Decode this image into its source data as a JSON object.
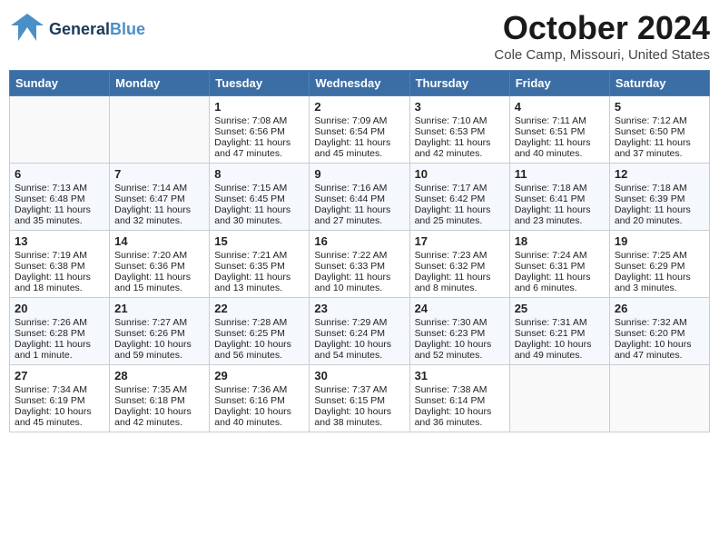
{
  "header": {
    "logo_line1": "General",
    "logo_line2": "Blue",
    "month_title": "October 2024",
    "location": "Cole Camp, Missouri, United States"
  },
  "days_of_week": [
    "Sunday",
    "Monday",
    "Tuesday",
    "Wednesday",
    "Thursday",
    "Friday",
    "Saturday"
  ],
  "weeks": [
    [
      {
        "day": "",
        "content": ""
      },
      {
        "day": "",
        "content": ""
      },
      {
        "day": "1",
        "content": "Sunrise: 7:08 AM\nSunset: 6:56 PM\nDaylight: 11 hours and 47 minutes."
      },
      {
        "day": "2",
        "content": "Sunrise: 7:09 AM\nSunset: 6:54 PM\nDaylight: 11 hours and 45 minutes."
      },
      {
        "day": "3",
        "content": "Sunrise: 7:10 AM\nSunset: 6:53 PM\nDaylight: 11 hours and 42 minutes."
      },
      {
        "day": "4",
        "content": "Sunrise: 7:11 AM\nSunset: 6:51 PM\nDaylight: 11 hours and 40 minutes."
      },
      {
        "day": "5",
        "content": "Sunrise: 7:12 AM\nSunset: 6:50 PM\nDaylight: 11 hours and 37 minutes."
      }
    ],
    [
      {
        "day": "6",
        "content": "Sunrise: 7:13 AM\nSunset: 6:48 PM\nDaylight: 11 hours and 35 minutes."
      },
      {
        "day": "7",
        "content": "Sunrise: 7:14 AM\nSunset: 6:47 PM\nDaylight: 11 hours and 32 minutes."
      },
      {
        "day": "8",
        "content": "Sunrise: 7:15 AM\nSunset: 6:45 PM\nDaylight: 11 hours and 30 minutes."
      },
      {
        "day": "9",
        "content": "Sunrise: 7:16 AM\nSunset: 6:44 PM\nDaylight: 11 hours and 27 minutes."
      },
      {
        "day": "10",
        "content": "Sunrise: 7:17 AM\nSunset: 6:42 PM\nDaylight: 11 hours and 25 minutes."
      },
      {
        "day": "11",
        "content": "Sunrise: 7:18 AM\nSunset: 6:41 PM\nDaylight: 11 hours and 23 minutes."
      },
      {
        "day": "12",
        "content": "Sunrise: 7:18 AM\nSunset: 6:39 PM\nDaylight: 11 hours and 20 minutes."
      }
    ],
    [
      {
        "day": "13",
        "content": "Sunrise: 7:19 AM\nSunset: 6:38 PM\nDaylight: 11 hours and 18 minutes."
      },
      {
        "day": "14",
        "content": "Sunrise: 7:20 AM\nSunset: 6:36 PM\nDaylight: 11 hours and 15 minutes."
      },
      {
        "day": "15",
        "content": "Sunrise: 7:21 AM\nSunset: 6:35 PM\nDaylight: 11 hours and 13 minutes."
      },
      {
        "day": "16",
        "content": "Sunrise: 7:22 AM\nSunset: 6:33 PM\nDaylight: 11 hours and 10 minutes."
      },
      {
        "day": "17",
        "content": "Sunrise: 7:23 AM\nSunset: 6:32 PM\nDaylight: 11 hours and 8 minutes."
      },
      {
        "day": "18",
        "content": "Sunrise: 7:24 AM\nSunset: 6:31 PM\nDaylight: 11 hours and 6 minutes."
      },
      {
        "day": "19",
        "content": "Sunrise: 7:25 AM\nSunset: 6:29 PM\nDaylight: 11 hours and 3 minutes."
      }
    ],
    [
      {
        "day": "20",
        "content": "Sunrise: 7:26 AM\nSunset: 6:28 PM\nDaylight: 11 hours and 1 minute."
      },
      {
        "day": "21",
        "content": "Sunrise: 7:27 AM\nSunset: 6:26 PM\nDaylight: 10 hours and 59 minutes."
      },
      {
        "day": "22",
        "content": "Sunrise: 7:28 AM\nSunset: 6:25 PM\nDaylight: 10 hours and 56 minutes."
      },
      {
        "day": "23",
        "content": "Sunrise: 7:29 AM\nSunset: 6:24 PM\nDaylight: 10 hours and 54 minutes."
      },
      {
        "day": "24",
        "content": "Sunrise: 7:30 AM\nSunset: 6:23 PM\nDaylight: 10 hours and 52 minutes."
      },
      {
        "day": "25",
        "content": "Sunrise: 7:31 AM\nSunset: 6:21 PM\nDaylight: 10 hours and 49 minutes."
      },
      {
        "day": "26",
        "content": "Sunrise: 7:32 AM\nSunset: 6:20 PM\nDaylight: 10 hours and 47 minutes."
      }
    ],
    [
      {
        "day": "27",
        "content": "Sunrise: 7:34 AM\nSunset: 6:19 PM\nDaylight: 10 hours and 45 minutes."
      },
      {
        "day": "28",
        "content": "Sunrise: 7:35 AM\nSunset: 6:18 PM\nDaylight: 10 hours and 42 minutes."
      },
      {
        "day": "29",
        "content": "Sunrise: 7:36 AM\nSunset: 6:16 PM\nDaylight: 10 hours and 40 minutes."
      },
      {
        "day": "30",
        "content": "Sunrise: 7:37 AM\nSunset: 6:15 PM\nDaylight: 10 hours and 38 minutes."
      },
      {
        "day": "31",
        "content": "Sunrise: 7:38 AM\nSunset: 6:14 PM\nDaylight: 10 hours and 36 minutes."
      },
      {
        "day": "",
        "content": ""
      },
      {
        "day": "",
        "content": ""
      }
    ]
  ]
}
